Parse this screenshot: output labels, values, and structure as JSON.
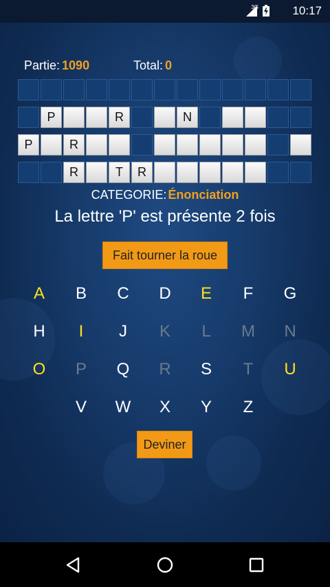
{
  "status_bar": {
    "time": "10:17",
    "network": "3G"
  },
  "scores": {
    "partie_label": "Partie:",
    "partie_value": "1090",
    "total_label": "Total:",
    "total_value": "0"
  },
  "board_rows": [
    [
      "",
      "",
      "",
      "",
      "",
      "",
      "",
      "",
      "",
      "",
      "",
      "",
      ""
    ],
    [
      "",
      "P",
      "",
      "",
      "R",
      "",
      "",
      "N",
      "",
      "",
      "",
      "",
      ""
    ],
    [
      "P",
      "",
      "R",
      "",
      "",
      "",
      "",
      "",
      "",
      "",
      "",
      "",
      ""
    ],
    [
      "",
      "",
      "R",
      "",
      "T",
      "R",
      "",
      "",
      "",
      "",
      "",
      "",
      ""
    ]
  ],
  "board_tiles": [
    [],
    [
      1,
      2,
      3,
      4,
      6,
      7,
      9,
      10
    ],
    [
      0,
      1,
      2,
      3,
      4,
      6,
      7,
      8,
      9,
      10,
      12
    ],
    [
      2,
      3,
      4,
      5,
      6,
      7,
      8,
      9,
      10
    ]
  ],
  "category": {
    "label": "CATEGORIE:",
    "value": "Énonciation"
  },
  "message": "La lettre 'P' est présente 2 fois",
  "spin_button": "Fait tourner la roue",
  "guess_button": "Deviner",
  "keyboard": [
    {
      "letter": "A",
      "state": "vowel"
    },
    {
      "letter": "B",
      "state": "available"
    },
    {
      "letter": "C",
      "state": "available"
    },
    {
      "letter": "D",
      "state": "available"
    },
    {
      "letter": "E",
      "state": "vowel"
    },
    {
      "letter": "F",
      "state": "available"
    },
    {
      "letter": "G",
      "state": "available"
    },
    {
      "letter": "H",
      "state": "available"
    },
    {
      "letter": "I",
      "state": "vowel"
    },
    {
      "letter": "J",
      "state": "available"
    },
    {
      "letter": "K",
      "state": "used"
    },
    {
      "letter": "L",
      "state": "used"
    },
    {
      "letter": "M",
      "state": "used"
    },
    {
      "letter": "N",
      "state": "used"
    },
    {
      "letter": "O",
      "state": "vowel"
    },
    {
      "letter": "P",
      "state": "used"
    },
    {
      "letter": "Q",
      "state": "available"
    },
    {
      "letter": "R",
      "state": "used"
    },
    {
      "letter": "S",
      "state": "available"
    },
    {
      "letter": "T",
      "state": "used"
    },
    {
      "letter": "U",
      "state": "vowel"
    },
    {
      "letter": "V",
      "state": "available"
    },
    {
      "letter": "W",
      "state": "available"
    },
    {
      "letter": "X",
      "state": "available"
    },
    {
      "letter": "Y",
      "state": "available"
    },
    {
      "letter": "Z",
      "state": "available"
    }
  ],
  "nav_icons": [
    "back-icon",
    "home-icon",
    "recents-icon"
  ]
}
